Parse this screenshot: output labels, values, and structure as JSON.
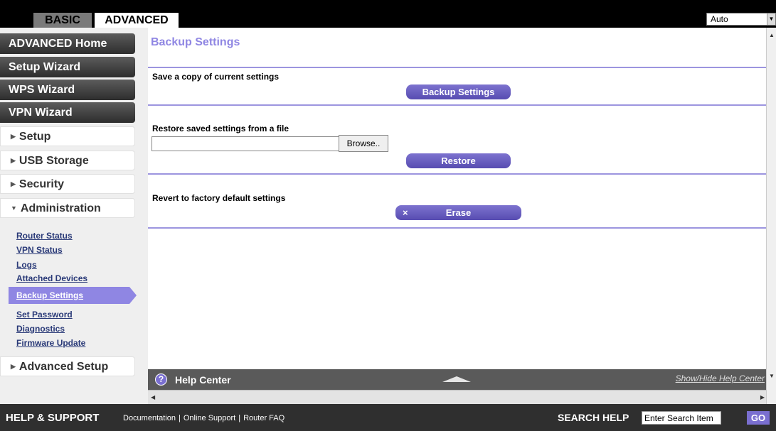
{
  "header": {
    "tabs": [
      {
        "label": "BASIC",
        "active": false
      },
      {
        "label": "ADVANCED",
        "active": true
      }
    ],
    "language": "Auto"
  },
  "sidebar": {
    "wizards": [
      "ADVANCED Home",
      "Setup Wizard",
      "WPS Wizard",
      "VPN Wizard"
    ],
    "menu": [
      "Setup",
      "USB Storage",
      "Security",
      "Administration",
      "Advanced Setup"
    ],
    "administration_items": [
      "Router Status",
      "VPN Status",
      "Logs",
      "Attached Devices",
      "Backup Settings",
      "Set Password",
      "Diagnostics",
      "Firmware Update"
    ],
    "active_item": "Backup Settings"
  },
  "main": {
    "title": "Backup Settings",
    "backup_label": "Save a copy of current settings",
    "backup_button": "Backup Settings",
    "restore_label": "Restore saved settings from a file",
    "browse_button": "Browse..",
    "restore_button": "Restore",
    "revert_label": "Revert to factory default settings",
    "erase_button": "Erase",
    "erase_icon": "×"
  },
  "help": {
    "icon": "?",
    "title": "Help Center",
    "toggle": "Show/Hide Help Center"
  },
  "footer": {
    "title": "HELP & SUPPORT",
    "links": [
      "Documentation",
      "Online Support",
      "Router FAQ"
    ],
    "search_label": "SEARCH HELP",
    "search_placeholder": "Enter Search Item",
    "go_button": "GO"
  },
  "colors": {
    "accent": "#8f86e3",
    "button": "#6a5fc4",
    "dark_bar": "#2f2f2f"
  }
}
